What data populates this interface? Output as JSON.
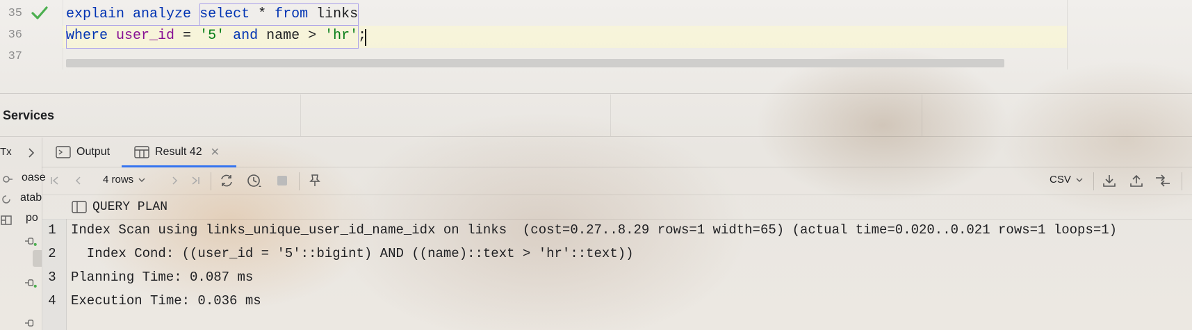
{
  "editor": {
    "line_numbers": [
      "35",
      "36",
      "37"
    ],
    "line35": [
      {
        "text": "explain",
        "cls": "kw"
      },
      {
        "text": " ",
        "cls": ""
      },
      {
        "text": "analyze",
        "cls": "kw"
      },
      {
        "text": " ",
        "cls": ""
      },
      {
        "text": "select",
        "cls": "kw"
      },
      {
        "text": " * ",
        "cls": ""
      },
      {
        "text": "from",
        "cls": "kw"
      },
      {
        "text": " links",
        "cls": ""
      }
    ],
    "line36": [
      {
        "text": "where",
        "cls": "kw"
      },
      {
        "text": " ",
        "cls": ""
      },
      {
        "text": "user_id",
        "cls": "id"
      },
      {
        "text": " = ",
        "cls": ""
      },
      {
        "text": "'5'",
        "cls": "str"
      },
      {
        "text": " ",
        "cls": ""
      },
      {
        "text": "and",
        "cls": "kw"
      },
      {
        "text": " name > ",
        "cls": ""
      },
      {
        "text": "'hr'",
        "cls": "str"
      },
      {
        "text": ";",
        "cls": ""
      }
    ],
    "status_icon": "checkmark-icon"
  },
  "services": {
    "title": "Services",
    "tree_fragments": [
      "Tx",
      "oase",
      "atab",
      "po"
    ]
  },
  "tabs": [
    {
      "label": "Output",
      "icon": "console-icon",
      "active": false
    },
    {
      "label": "Result 42",
      "icon": "table-icon",
      "active": true
    }
  ],
  "toolbar": {
    "rows_label": "4 rows",
    "format_label": "CSV"
  },
  "result": {
    "column_title": "QUERY PLAN",
    "rows": [
      {
        "num": "1",
        "text": "Index Scan using links_unique_user_id_name_idx on links  (cost=0.27..8.29 rows=1 width=65) (actual time=0.020..0.021 rows=1 loops=1)"
      },
      {
        "num": "2",
        "text": "  Index Cond: ((user_id = '5'::bigint) AND ((name)::text > 'hr'::text))"
      },
      {
        "num": "3",
        "text": "Planning Time: 0.087 ms"
      },
      {
        "num": "4",
        "text": "Execution Time: 0.036 ms"
      }
    ]
  },
  "colors": {
    "keyword": "#0033b3",
    "identifier": "#871094",
    "string": "#067d17",
    "accent": "#3574f0",
    "check": "#4caf50"
  }
}
